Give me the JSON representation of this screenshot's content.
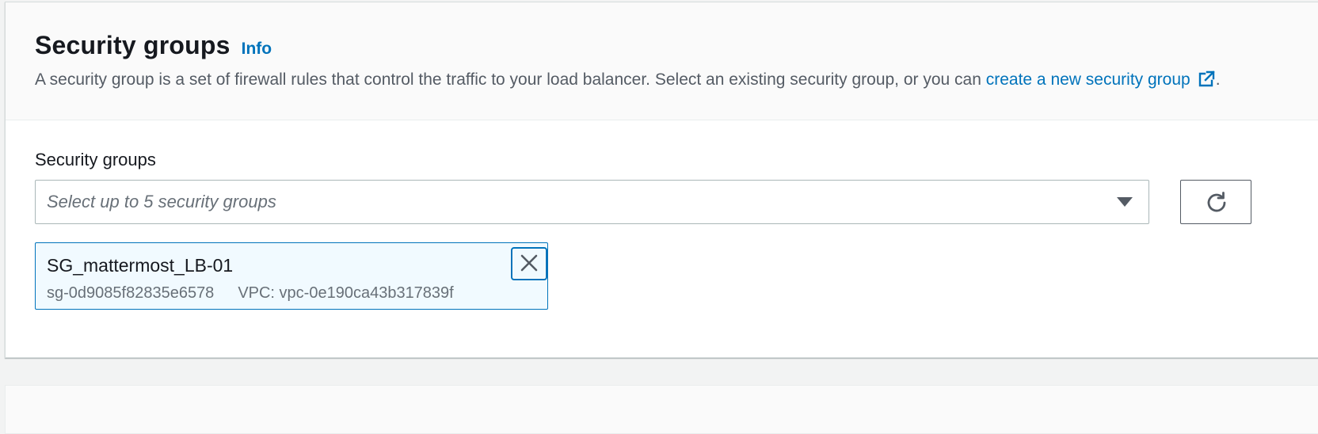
{
  "header": {
    "title": "Security groups",
    "info_label": "Info",
    "description_text": "A security group is a set of firewall rules that control the traffic to your load balancer. Select an existing security group, or you can ",
    "create_link_label": "create a new security group",
    "description_end": "."
  },
  "field": {
    "label": "Security groups",
    "placeholder": "Select up to 5 security groups"
  },
  "selected_groups": [
    {
      "name": "SG_mattermost_LB-01",
      "id": "sg-0d9085f82835e6578",
      "vpc": "VPC: vpc-0e190ca43b317839f"
    }
  ],
  "icons": {
    "external": "external-link-icon",
    "caret": "caret-down-icon",
    "refresh": "refresh-icon",
    "dismiss": "close-icon"
  },
  "colors": {
    "link": "#0073bb",
    "token_background": "#f1faff",
    "token_border": "#0073bb",
    "text_primary": "#16191f",
    "text_secondary": "#545b64"
  }
}
